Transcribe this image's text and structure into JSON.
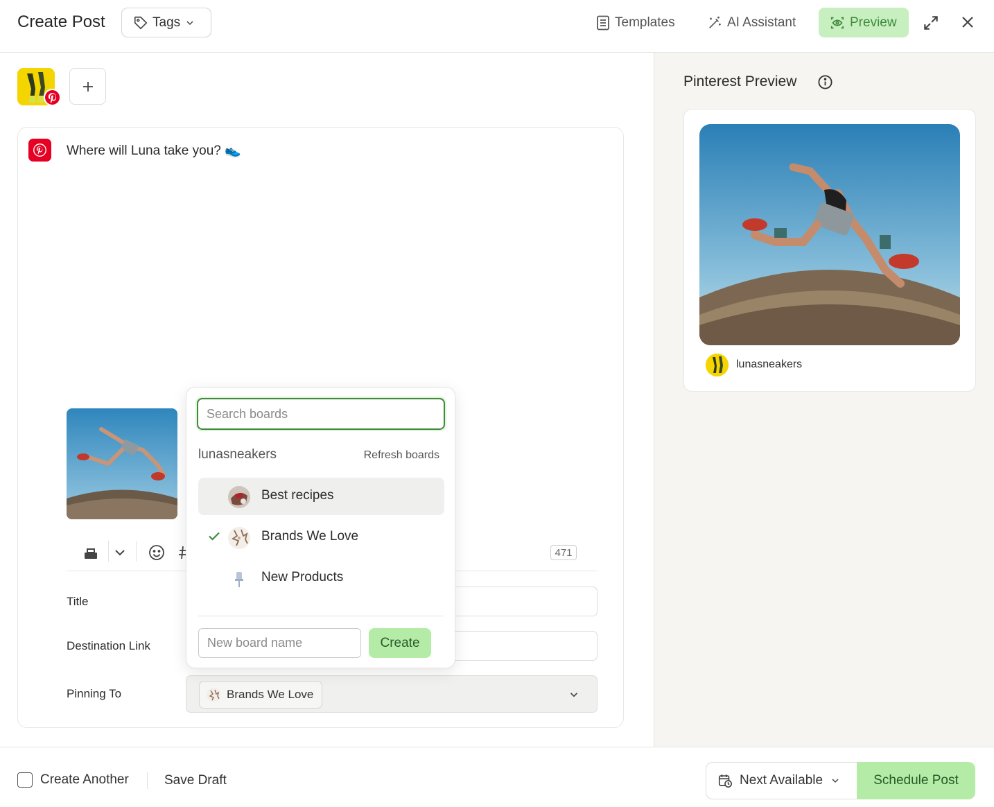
{
  "header": {
    "title": "Create Post",
    "tags_label": "Tags",
    "templates_label": "Templates",
    "ai_label": "AI Assistant",
    "preview_label": "Preview"
  },
  "editor": {
    "post_text": "Where will Luna take you? 👟",
    "char_count": "471",
    "fields": {
      "title_label": "Title",
      "destination_label": "Destination Link",
      "pinning_label": "Pinning To",
      "pinning_value": "Brands We Love"
    }
  },
  "board_dropdown": {
    "search_placeholder": "Search boards",
    "account": "lunasneakers",
    "refresh_label": "Refresh boards",
    "boards": [
      {
        "label": "Best recipes",
        "selected": false,
        "hovered": true
      },
      {
        "label": "Brands We Love",
        "selected": true,
        "hovered": false
      },
      {
        "label": "New Products",
        "selected": false,
        "hovered": false
      }
    ],
    "new_board_placeholder": "New board name",
    "create_label": "Create"
  },
  "preview": {
    "title": "Pinterest Preview",
    "username": "lunasneakers"
  },
  "footer": {
    "create_another": "Create Another",
    "save_draft": "Save Draft",
    "next_available": "Next Available",
    "schedule": "Schedule Post"
  },
  "colors": {
    "accent_green": "#3f8b3b",
    "button_green": "#b3eba7",
    "pinterest_red": "#e60023",
    "panel_bg": "#f6f5f1"
  }
}
